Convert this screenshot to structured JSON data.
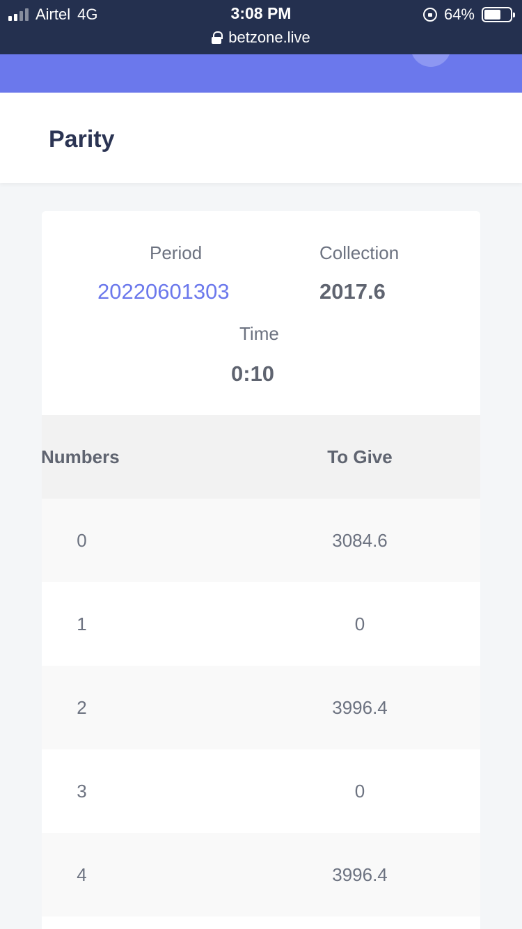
{
  "status_bar": {
    "carrier": "Airtel",
    "network": "4G",
    "time": "3:08 PM",
    "battery_percent": "64%",
    "battery_level": 0.64,
    "url": "betzone.live"
  },
  "colors": {
    "status_bar_bg": "#24304f",
    "header_accent": "#6b78ec",
    "title_text": "#2b3453",
    "period_value": "#6b78ec"
  },
  "page": {
    "title": "Parity"
  },
  "stats": {
    "period_label": "Period",
    "period_value": "20220601303",
    "collection_label": "Collection",
    "collection_value": "2017.6",
    "time_label": "Time",
    "time_value": "0:10"
  },
  "table": {
    "headers": [
      "Numbers",
      "To Give"
    ],
    "rows": [
      [
        "0",
        "3084.6"
      ],
      [
        "1",
        "0"
      ],
      [
        "2",
        "3996.4"
      ],
      [
        "3",
        "0"
      ],
      [
        "4",
        "3996.4"
      ]
    ]
  }
}
